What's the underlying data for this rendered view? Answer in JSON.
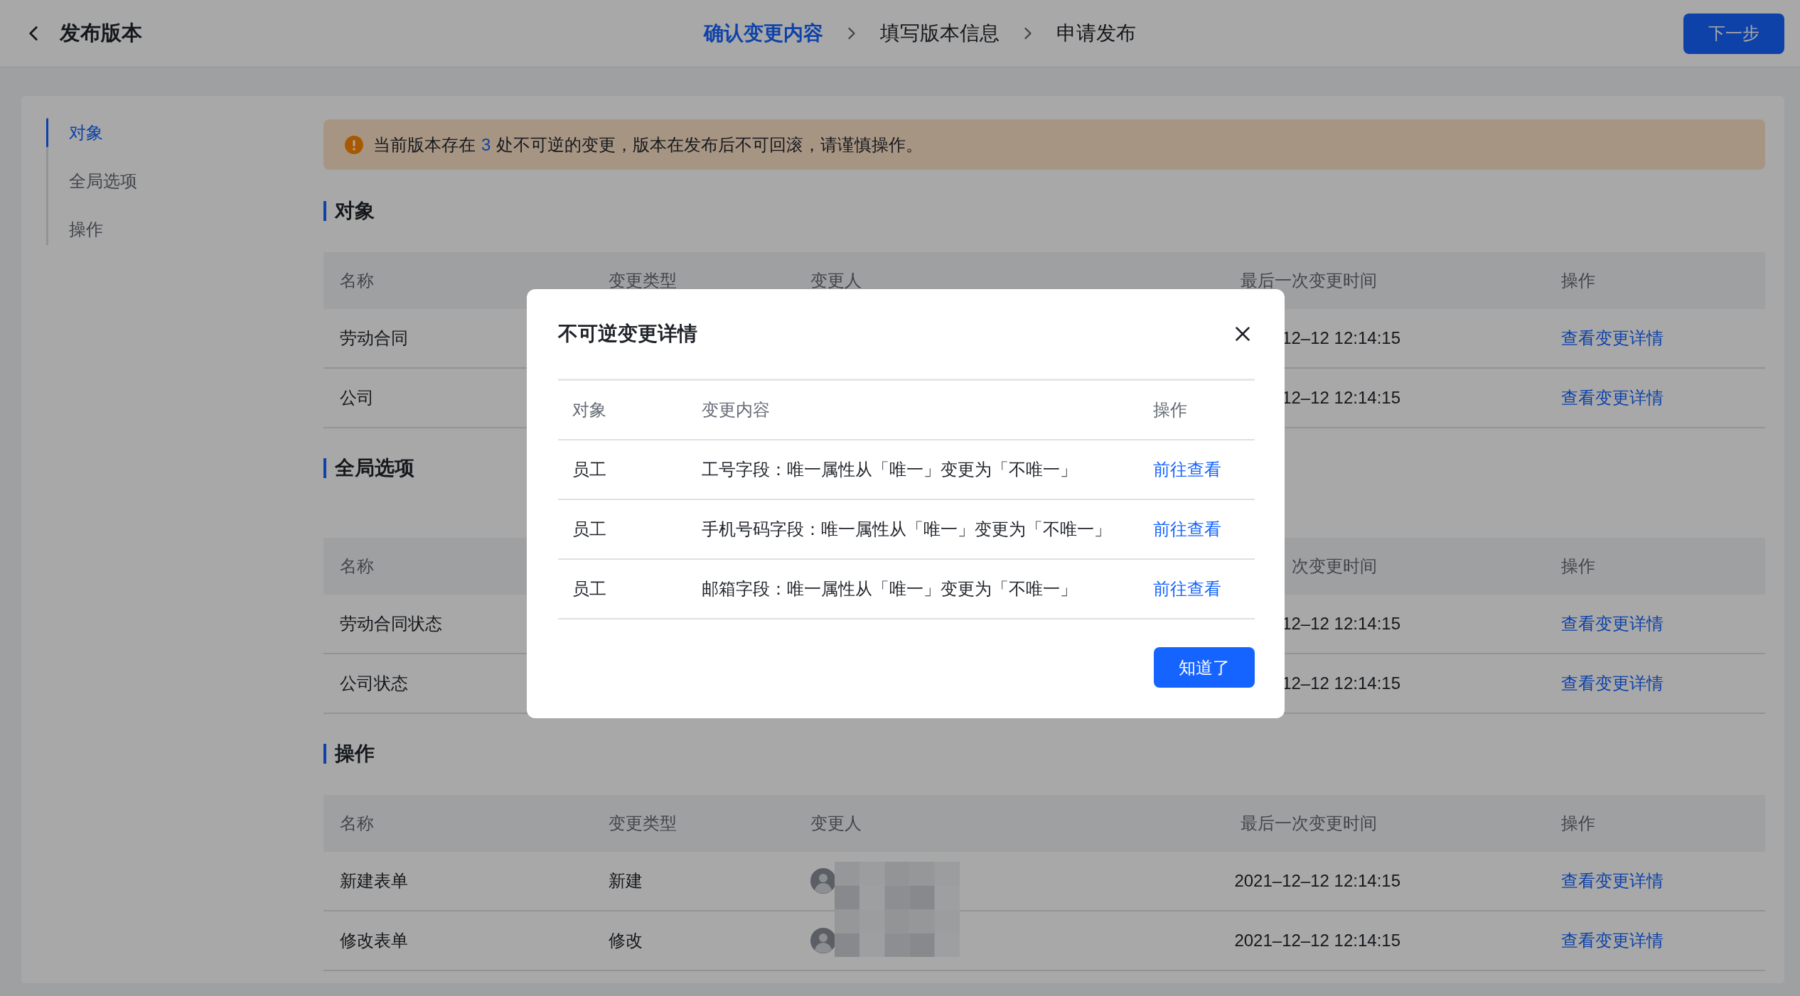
{
  "header": {
    "title": "发布版本",
    "steps": [
      {
        "label": "确认变更内容",
        "selected": true
      },
      {
        "label": "填写版本信息",
        "selected": false
      },
      {
        "label": "申请发布",
        "selected": false
      }
    ],
    "next_button": "下一步"
  },
  "sidebar": {
    "items": [
      {
        "label": "对象",
        "selected": true
      },
      {
        "label": "全局选项",
        "selected": false
      },
      {
        "label": "操作",
        "selected": false
      }
    ]
  },
  "banner": {
    "before": "当前版本存在",
    "count": "3",
    "after": "处不可逆的变更，版本在发布后不可回滚，请谨慎操作。"
  },
  "sections": [
    {
      "title": "对象",
      "columns": [
        {
          "kind": "name",
          "label": "名称"
        },
        {
          "kind": "type",
          "label": "变更类型"
        },
        {
          "kind": "person",
          "label": "变更人"
        },
        {
          "kind": "time",
          "label": "最后一次变更时间"
        },
        {
          "kind": "action",
          "label": "操作"
        }
      ],
      "rows": [
        {
          "name": "劳动合同",
          "time": "12–12 12:14:15",
          "action": "查看变更详情"
        },
        {
          "name": "公司",
          "time": "12–12 12:14:15",
          "action": "查看变更详情"
        }
      ]
    },
    {
      "title": "全局选项",
      "columns": [
        {
          "kind": "name",
          "label": "名称"
        },
        {
          "kind": "time",
          "label": "次变更时间"
        },
        {
          "kind": "action",
          "label": "操作"
        }
      ],
      "rows": [
        {
          "name": "劳动合同状态",
          "time": "12–12 12:14:15",
          "action": "查看变更详情"
        },
        {
          "name": "公司状态",
          "time": "12–12 12:14:15",
          "action": "查看变更详情"
        }
      ]
    },
    {
      "title": "操作",
      "columns": [
        {
          "kind": "name",
          "label": "名称"
        },
        {
          "kind": "type",
          "label": "变更类型"
        },
        {
          "kind": "person",
          "label": "变更人"
        },
        {
          "kind": "time",
          "label": "最后一次变更时间"
        },
        {
          "kind": "action",
          "label": "操作"
        }
      ],
      "rows": [
        {
          "name": "新建表单",
          "type": "新建",
          "avatar": true,
          "time": "2021–12–12 12:14:15",
          "action": "查看变更详情"
        },
        {
          "name": "修改表单",
          "type": "修改",
          "avatar": true,
          "time": "2021–12–12 12:14:15",
          "action": "查看变更详情"
        }
      ]
    }
  ],
  "modal": {
    "title": "不可逆变更详情",
    "columns": [
      "对象",
      "变更内容",
      "操作"
    ],
    "rows": [
      {
        "object": "员工",
        "change": "工号字段：唯一属性从「唯一」变更为「不唯一」",
        "action": "前往查看"
      },
      {
        "object": "员工",
        "change": "手机号码字段：唯一属性从「唯一」变更为「不唯一」",
        "action": "前往查看"
      },
      {
        "object": "员工",
        "change": "邮箱字段：唯一属性从「唯一」变更为「不唯一」",
        "action": "前往查看"
      }
    ],
    "button": "知道了"
  }
}
